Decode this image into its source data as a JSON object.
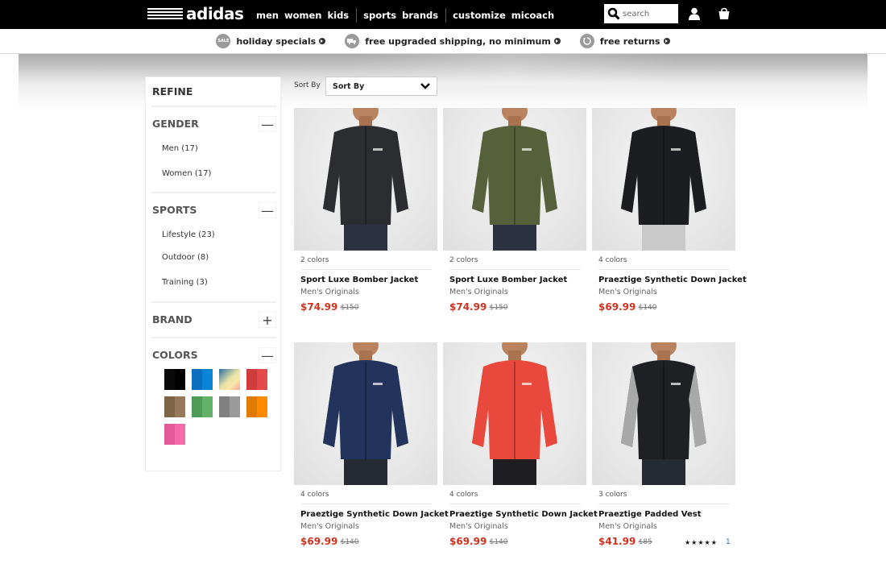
{
  "header": {
    "brand": "adidas",
    "nav": [
      "men",
      "women",
      "kids",
      "sports",
      "brands",
      "customize",
      "micoach"
    ],
    "search_placeholder": "search"
  },
  "promo": [
    {
      "icon": "sale-icon",
      "badge": "SALE",
      "label": "holiday specials"
    },
    {
      "icon": "truck-icon",
      "label": "free upgraded shipping, no minimum"
    },
    {
      "icon": "return-icon",
      "label": "free returns"
    }
  ],
  "sidebar": {
    "title": "REFINE",
    "sections": [
      {
        "name": "GENDER",
        "toggle": "—",
        "options": [
          "Men (17)",
          "Women (17)"
        ]
      },
      {
        "name": "SPORTS",
        "toggle": "—",
        "options": [
          "Lifestyle (23)",
          "Outdoor (8)",
          "Training (3)"
        ]
      },
      {
        "name": "BRAND",
        "toggle": "+",
        "options": []
      },
      {
        "name": "COLORS",
        "toggle": "—",
        "options": []
      }
    ],
    "colors": [
      {
        "name": "black",
        "c1": "#0a0a0a",
        "c2": "#000000"
      },
      {
        "name": "blue",
        "c1": "#0a6fbf",
        "c2": "#0a84d6"
      },
      {
        "name": "multicolor",
        "c1": "#2b6aa0",
        "c2": "#fbe6a8"
      },
      {
        "name": "red",
        "c1": "#cf3c3c",
        "c2": "#e34b4b"
      },
      {
        "name": "brown",
        "c1": "#7f6548",
        "c2": "#98785a"
      },
      {
        "name": "green",
        "c1": "#4f9a57",
        "c2": "#62b268"
      },
      {
        "name": "grey",
        "c1": "#808080",
        "c2": "#9a9a9a"
      },
      {
        "name": "orange",
        "c1": "#e07a00",
        "c2": "#ff8a00"
      },
      {
        "name": "pink",
        "c1": "#e25a9a",
        "c2": "#f56aaa"
      }
    ]
  },
  "sort": {
    "label": "Sort By",
    "selected": "Sort By"
  },
  "products": [
    {
      "colors": "2 colors",
      "name": "Sport Luxe Bomber Jacket",
      "category": "Men's Originals",
      "price": "$74.99",
      "original": "$150",
      "jacket": "#2c2d30",
      "pants": "#2b3140"
    },
    {
      "colors": "2 colors",
      "name": "Sport Luxe Bomber Jacket",
      "category": "Men's Originals",
      "price": "$74.99",
      "original": "$150",
      "jacket": "#56603a",
      "pants": "#2b3140"
    },
    {
      "colors": "4 colors",
      "name": "Praeztige Synthetic Down Jacket",
      "category": "Men's Originals",
      "price": "$69.99",
      "original": "$140",
      "jacket": "#1c1d20",
      "pants": "#c9c9c9"
    },
    {
      "colors": "4 colors",
      "name": "Praeztige Synthetic Down Jacket",
      "category": "Men's Originals",
      "price": "$69.99",
      "original": "$140",
      "jacket": "#22335c",
      "pants": "#262a33"
    },
    {
      "colors": "4 colors",
      "name": "Praeztige Synthetic Down Jacket",
      "category": "Men's Originals",
      "price": "$69.99",
      "original": "$140",
      "jacket": "#e8493c",
      "pants": "#1e1e22"
    },
    {
      "colors": "3 colors",
      "name": "Praeztige Padded Vest",
      "category": "Men's Originals",
      "price": "$41.99",
      "original": "$85",
      "jacket": "#1f2024",
      "pants": "#262a33",
      "sleeves": "#a9a9a9",
      "rating": "★★★★★",
      "reviews": "1"
    }
  ]
}
